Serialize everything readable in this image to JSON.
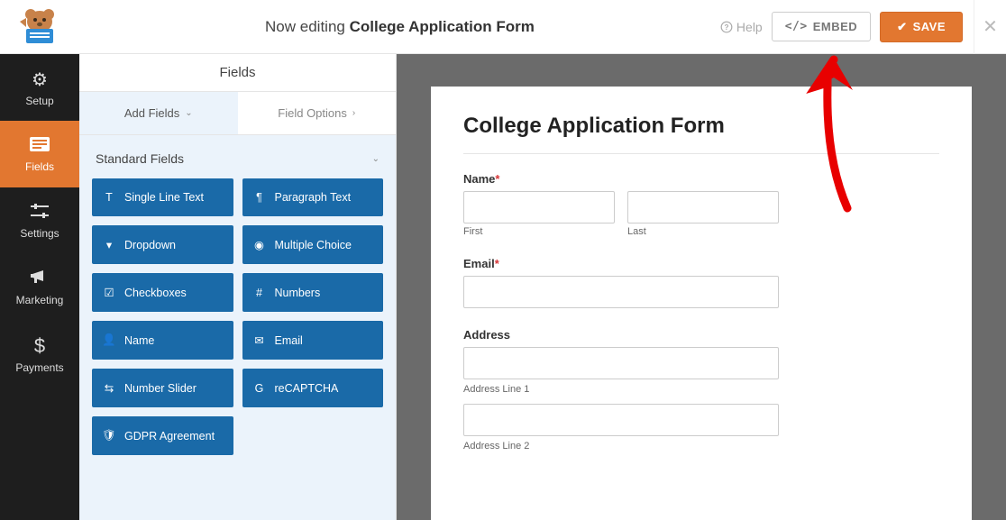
{
  "topbar": {
    "editing_prefix": "Now editing",
    "editing_name": "College Application Form",
    "help_label": "Help",
    "embed_label": "EMBED",
    "save_label": "SAVE"
  },
  "sidebar": {
    "items": [
      {
        "label": "Setup"
      },
      {
        "label": "Fields"
      },
      {
        "label": "Settings"
      },
      {
        "label": "Marketing"
      },
      {
        "label": "Payments"
      }
    ]
  },
  "panel": {
    "header": "Fields",
    "tab_add": "Add Fields",
    "tab_options": "Field Options",
    "section_standard": "Standard Fields",
    "fields": {
      "single_line": "Single Line Text",
      "paragraph": "Paragraph Text",
      "dropdown": "Dropdown",
      "multiple_choice": "Multiple Choice",
      "checkboxes": "Checkboxes",
      "numbers": "Numbers",
      "name": "Name",
      "email": "Email",
      "number_slider": "Number Slider",
      "recaptcha": "reCAPTCHA",
      "gdpr": "GDPR Agreement"
    }
  },
  "preview": {
    "form_title": "College Application Form",
    "name_label": "Name",
    "first_sublabel": "First",
    "last_sublabel": "Last",
    "email_label": "Email",
    "address_label": "Address",
    "addr1_sublabel": "Address Line 1",
    "addr2_sublabel": "Address Line 2"
  }
}
